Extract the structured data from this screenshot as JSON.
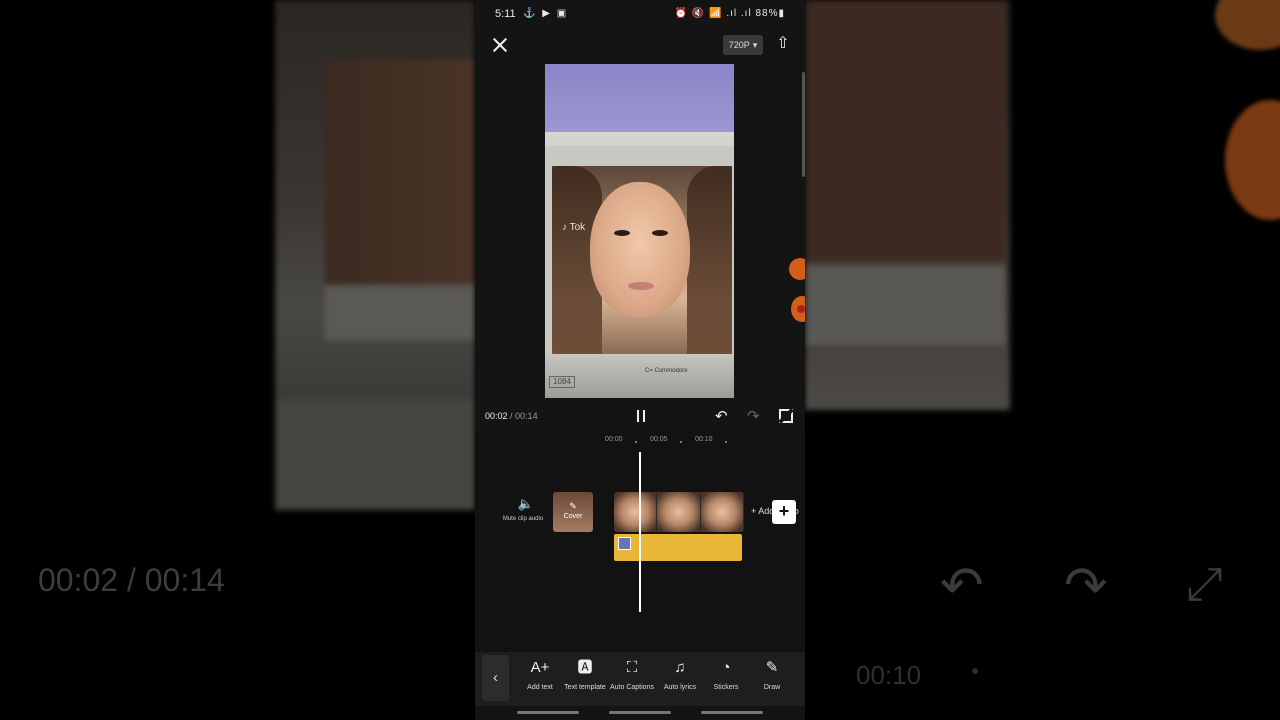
{
  "status_bar": {
    "time": "5:11",
    "left_icons": "⚓ ▶ ▣",
    "right_icons": "⏰ 🔇 📶 .ıl .ıl",
    "battery": "88%"
  },
  "top_bar": {
    "resolution": "720P",
    "resolution_caret": "▾",
    "export_icon": "⇧"
  },
  "preview": {
    "tiktok_label": "♪ Tok",
    "badge": "1084",
    "brand": "C= Commodore"
  },
  "playback": {
    "current_time": "00:02",
    "separator": " / ",
    "duration": "00:14"
  },
  "timeline": {
    "ruler": [
      "00:00",
      "00:05",
      "00:10"
    ],
    "mute_label": "Mute clip audio",
    "cover_label": "Cover",
    "add_audio_label": "+ Add audio",
    "add_clip_label": "+"
  },
  "toolbar": {
    "back_icon": "‹",
    "tools": [
      {
        "icon": "A+",
        "label": "Add text"
      },
      {
        "icon": "🅰",
        "label": "Text template"
      },
      {
        "icon": "⛶",
        "label": "Auto Captions"
      },
      {
        "icon": "♫",
        "label": "Auto lyrics"
      },
      {
        "icon": "◔",
        "label": "Stickers"
      },
      {
        "icon": "✎",
        "label": "Draw"
      }
    ]
  },
  "background": {
    "time_readout": "00:02 / 00:14",
    "time_readout2": "00:10"
  },
  "colors": {
    "accent_track": "#eab637",
    "app_bg": "#141414",
    "side_tool": "#d35d1a"
  }
}
